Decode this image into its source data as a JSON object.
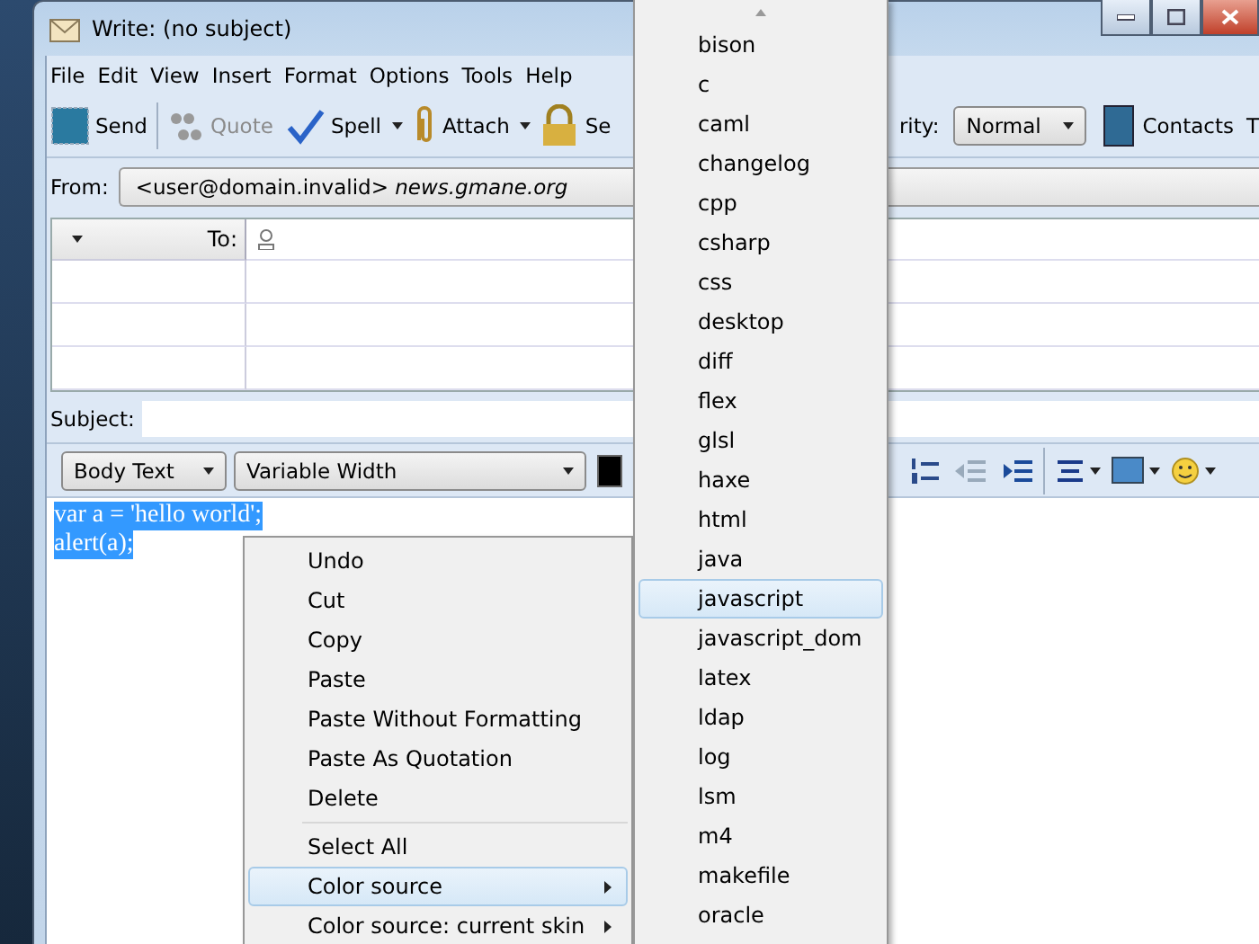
{
  "window": {
    "title": "Write: (no subject)"
  },
  "menu_bar": [
    "File",
    "Edit",
    "View",
    "Insert",
    "Format",
    "Options",
    "Tools",
    "Help"
  ],
  "toolbar": [
    {
      "kind": "send",
      "label": "Send",
      "disabled": false
    },
    {
      "kind": "quote",
      "label": "Quote",
      "disabled": true
    },
    {
      "kind": "spell",
      "label": "Spell",
      "disabled": false
    },
    {
      "kind": "attach",
      "label": "Attach",
      "disabled": false
    },
    {
      "kind": "security",
      "label": "Se",
      "disabled": false
    }
  ],
  "priority": {
    "label": "rity:",
    "value": "Normal"
  },
  "contacts": {
    "label": "Contacts",
    "cut_label": "T"
  },
  "from": {
    "label": "From:",
    "value": "<user@domain.invalid> *news.gmane.org*"
  },
  "recipients": {
    "type_label": "To:"
  },
  "subject": {
    "label": "Subject:"
  },
  "format_bar": {
    "paragraph": "Body Text",
    "font": "Variable Width"
  },
  "body": {
    "lines": [
      "var a = 'hello world';",
      "alert(a);"
    ],
    "selected": true
  },
  "context_menu": [
    {
      "kind": "item",
      "label": "Undo",
      "selected": false,
      "submenu": false
    },
    {
      "kind": "item",
      "label": "Cut",
      "selected": false,
      "submenu": false
    },
    {
      "kind": "item",
      "label": "Copy",
      "selected": false,
      "submenu": false
    },
    {
      "kind": "item",
      "label": "Paste",
      "selected": false,
      "submenu": false
    },
    {
      "kind": "item",
      "label": "Paste Without Formatting",
      "selected": false,
      "submenu": false
    },
    {
      "kind": "item",
      "label": "Paste As Quotation",
      "selected": false,
      "submenu": false
    },
    {
      "kind": "item",
      "label": "Delete",
      "selected": false,
      "submenu": false
    },
    {
      "kind": "separator"
    },
    {
      "kind": "item",
      "label": "Select All",
      "selected": false,
      "submenu": false
    },
    {
      "kind": "item",
      "label": "Color source",
      "selected": true,
      "submenu": true
    },
    {
      "kind": "item",
      "label": "Color source: current skin",
      "selected": false,
      "submenu": true
    }
  ],
  "submenu": [
    {
      "label": "bison",
      "selected": false
    },
    {
      "label": "c",
      "selected": false
    },
    {
      "label": "caml",
      "selected": false
    },
    {
      "label": "changelog",
      "selected": false
    },
    {
      "label": "cpp",
      "selected": false
    },
    {
      "label": "csharp",
      "selected": false
    },
    {
      "label": "css",
      "selected": false
    },
    {
      "label": "desktop",
      "selected": false
    },
    {
      "label": "diff",
      "selected": false
    },
    {
      "label": "flex",
      "selected": false
    },
    {
      "label": "glsl",
      "selected": false
    },
    {
      "label": "haxe",
      "selected": false
    },
    {
      "label": "html",
      "selected": false
    },
    {
      "label": "java",
      "selected": false
    },
    {
      "label": "javascript",
      "selected": true
    },
    {
      "label": "javascript_dom",
      "selected": false
    },
    {
      "label": "latex",
      "selected": false
    },
    {
      "label": "ldap",
      "selected": false
    },
    {
      "label": "log",
      "selected": false
    },
    {
      "label": "lsm",
      "selected": false
    },
    {
      "label": "m4",
      "selected": false
    },
    {
      "label": "makefile",
      "selected": false
    },
    {
      "label": "oracle",
      "selected": false
    }
  ]
}
